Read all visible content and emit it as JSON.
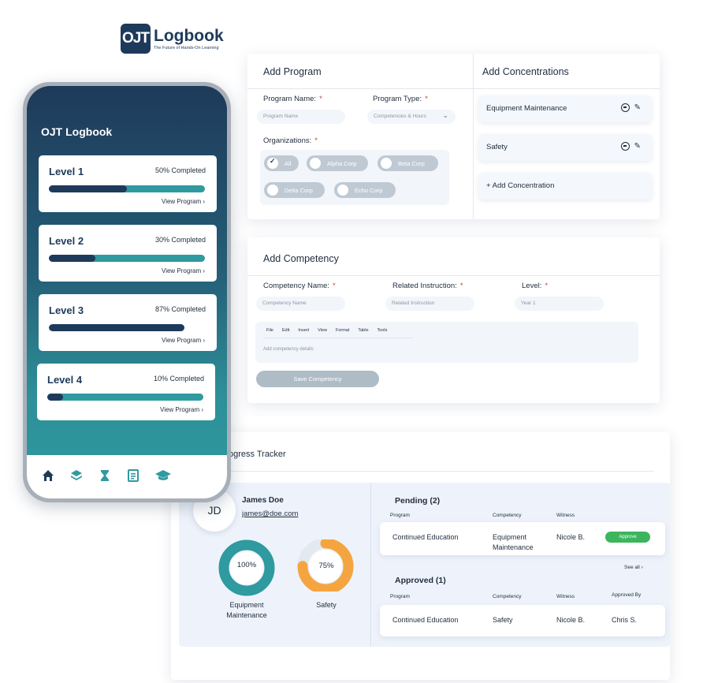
{
  "logo": {
    "mark": "OJT",
    "title": "Logbook",
    "tagline": "The Future of Hands-On Learning"
  },
  "program": {
    "title": "Add Program",
    "name_label": "Program Name:",
    "name_placeholder": "Program Name",
    "type_label": "Program Type:",
    "type_placeholder": "Competencies & Hours",
    "orgs_label": "Organizations:",
    "required_mark": "*",
    "orgs": [
      {
        "label": "All",
        "selected": true
      },
      {
        "label": "Alpha Corp",
        "selected": false
      },
      {
        "label": "Beta Corp",
        "selected": false
      },
      {
        "label": "Delta Corp",
        "selected": false
      },
      {
        "label": "Echo Corp",
        "selected": false
      }
    ]
  },
  "concentrations": {
    "title": "Add Concentrations",
    "items": [
      "Equipment Maintenance",
      "Safety"
    ],
    "add_label": "+ Add Concentration"
  },
  "competency": {
    "title": "Add Competency",
    "name_label": "Competency Name:",
    "name_placeholder": "Competency Name",
    "instruction_label": "Related Instruction:",
    "instruction_placeholder": "Related Instruction",
    "level_label": "Level:",
    "level_placeholder": "Year 1",
    "editor_menu": [
      "File",
      "Edit",
      "Insert",
      "View",
      "Format",
      "Table",
      "Tools"
    ],
    "editor_placeholder": "Add competency details",
    "save_label": "Save Competency"
  },
  "tracker": {
    "title": "Learner Progress Tracker",
    "user": {
      "initials": "JD",
      "name": "James Doe",
      "email": "james@doe.com"
    },
    "rings": [
      {
        "value": 100,
        "label_text": "100%",
        "name": "Equipment Maintenance",
        "color": "#2f9aa0"
      },
      {
        "value": 75,
        "label_text": "75%",
        "name": "Safety",
        "color": "#f5a540"
      }
    ],
    "pending": {
      "title": "Pending (2)",
      "headers": [
        "Program",
        "Competency",
        "Witness"
      ],
      "row": {
        "program": "Continued Education",
        "competency": "Equipment Maintenance",
        "witness": "Nicole B.",
        "action": "Approve"
      },
      "see_all": "See all ›"
    },
    "approved": {
      "title": "Approved (1)",
      "headers": [
        "Program",
        "Competency",
        "Witness",
        "Approved By"
      ],
      "row": {
        "program": "Continued Education",
        "competency": "Safety",
        "witness": "Nicole B.",
        "approved_by": "Chris S."
      }
    }
  },
  "phone": {
    "app_title": "OJT Logbook",
    "levels": [
      {
        "name": "Level 1",
        "progress": 50,
        "status": "50% Completed",
        "link": "View Program ›"
      },
      {
        "name": "Level 2",
        "progress": 30,
        "status": "30% Completed",
        "link": "View Program ›"
      },
      {
        "name": "Level 3",
        "progress": 87,
        "status": "87% Completed",
        "link": "View Program ›"
      },
      {
        "name": "Level 4",
        "progress": 10,
        "status": "10% Completed",
        "link": "View Program ›"
      }
    ],
    "nav_icons": [
      "home-icon",
      "layers-icon",
      "hourglass-icon",
      "document-icon",
      "graduation-cap-icon"
    ]
  },
  "colors": {
    "navy": "#1e3a5a",
    "teal": "#2f9aa0",
    "orange": "#f5a540",
    "green": "#3cb55c",
    "required": "#d03a3a"
  }
}
